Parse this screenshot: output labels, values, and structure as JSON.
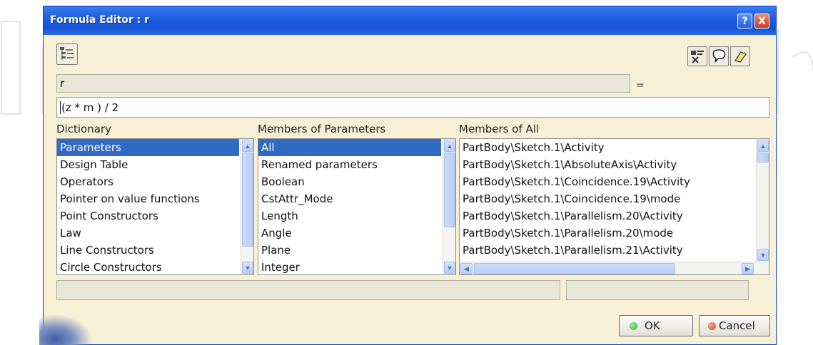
{
  "window": {
    "title": "Formula Editor : r",
    "help_label": "?",
    "close_label": "X"
  },
  "parameter": {
    "name": "r",
    "equals": "=",
    "formula": "(z * m ) / 2"
  },
  "dictionary": {
    "label": "Dictionary",
    "items": [
      "Parameters",
      "Design Table",
      "Operators",
      "Pointer on value functions",
      "Point Constructors",
      "Law",
      "Line Constructors",
      "Circle Constructors"
    ],
    "selected_index": 0
  },
  "members_of_parameters": {
    "label": "Members of Parameters",
    "items": [
      "All",
      "Renamed parameters",
      "Boolean",
      "CstAttr_Mode",
      "Length",
      "Angle",
      "Plane",
      "Integer"
    ],
    "selected_index": 0
  },
  "members_of_all": {
    "label": "Members of All",
    "items": [
      "PartBody\\Sketch.1\\Activity",
      "PartBody\\Sketch.1\\AbsoluteAxis\\Activity",
      "PartBody\\Sketch.1\\Coincidence.19\\Activity",
      "PartBody\\Sketch.1\\Coincidence.19\\mode",
      "PartBody\\Sketch.1\\Parallelism.20\\Activity",
      "PartBody\\Sketch.1\\Parallelism.20\\mode",
      "PartBody\\Sketch.1\\Parallelism.21\\Activity"
    ]
  },
  "buttons": {
    "ok": "OK",
    "cancel": "Cancel"
  },
  "colors": {
    "title_bar": "#1e5ee0",
    "selection": "#316ac5",
    "dialog_bg": "#f7f0d6",
    "ok_dot": "#2fa52f",
    "cancel_dot": "#d23a2a"
  },
  "icons": {
    "toolbar_left": "parameter-tree-icon",
    "toolbar_right": [
      "measure-icon",
      "comment-icon",
      "eraser-icon"
    ]
  }
}
